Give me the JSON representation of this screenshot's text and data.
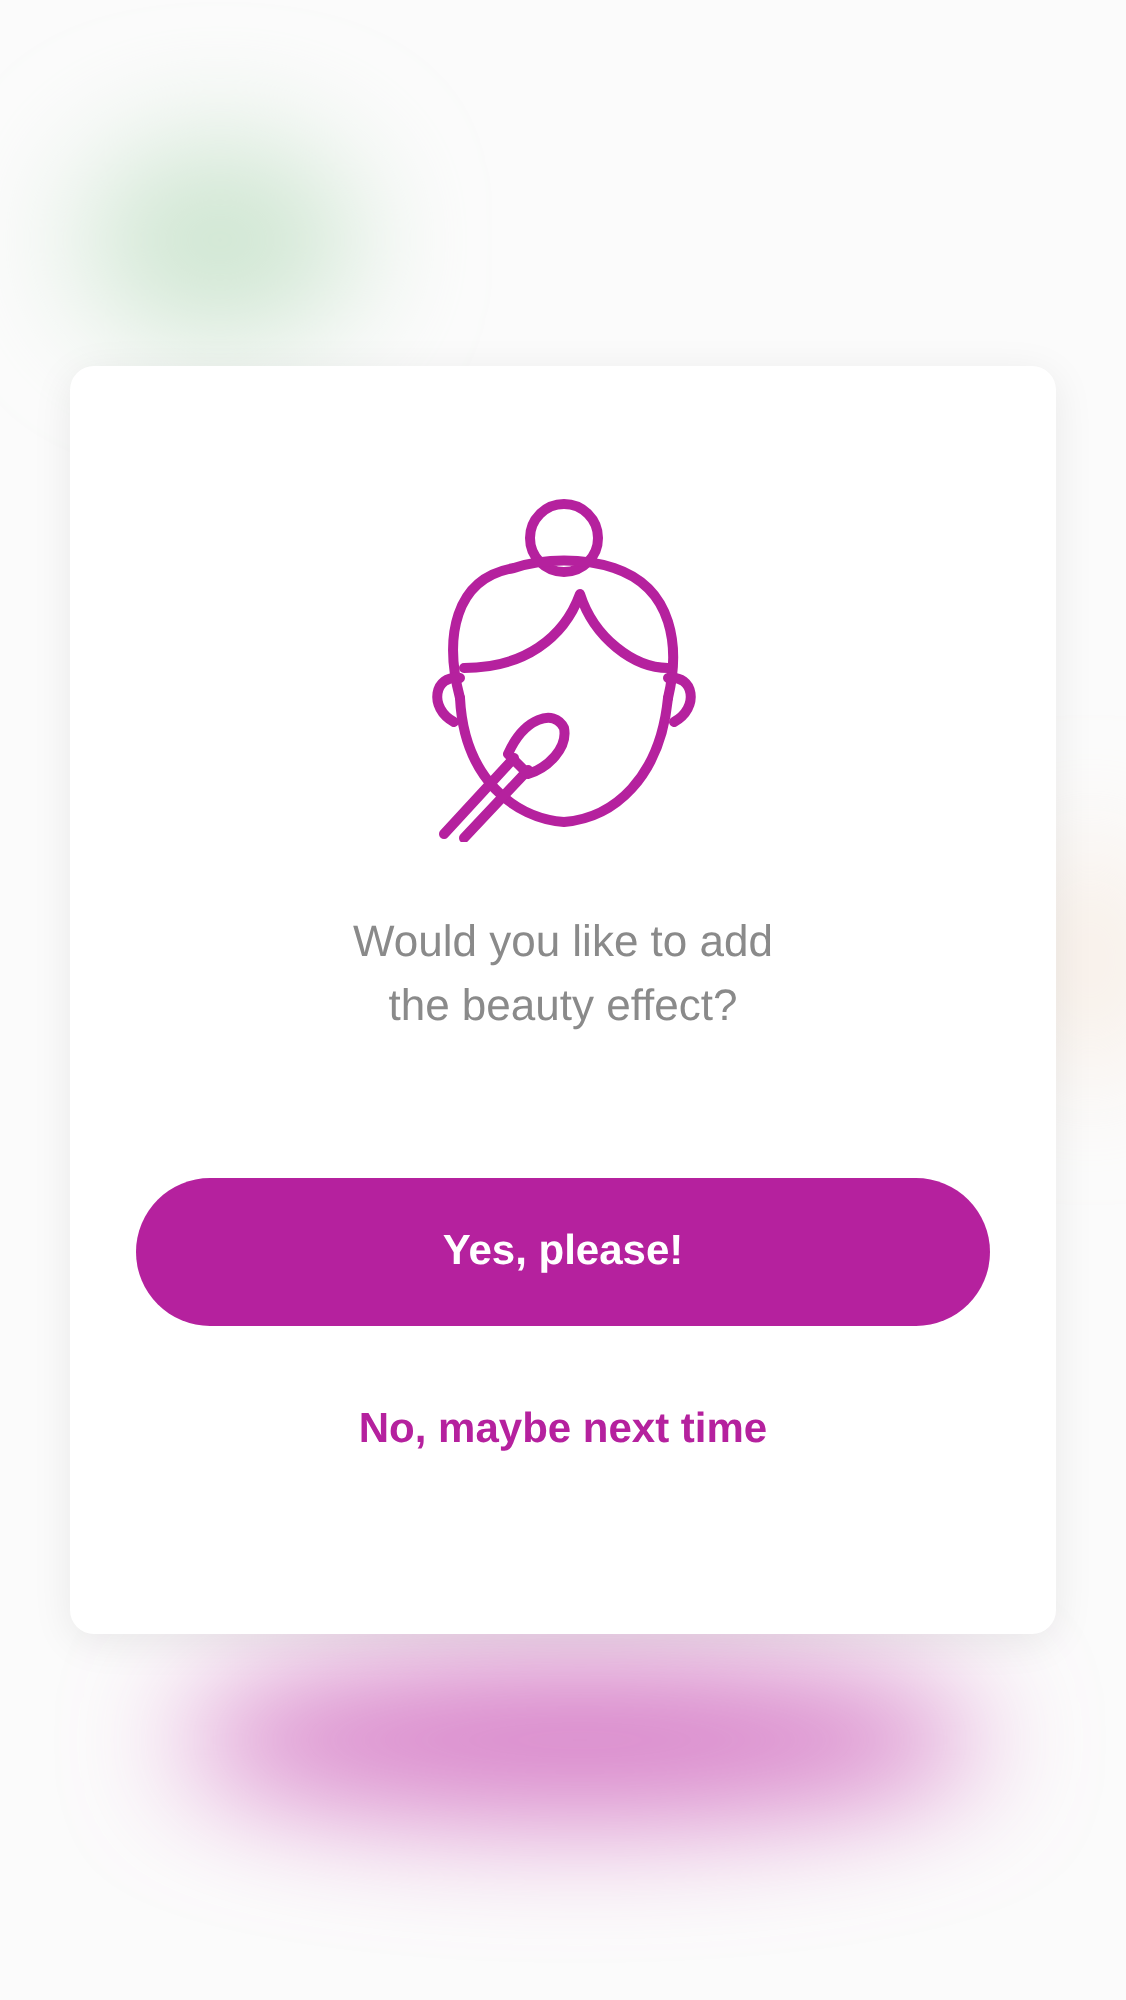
{
  "dialog": {
    "message": "Would you like to add the beauty effect?",
    "primary_button": "Yes, please!",
    "secondary_link": "No, maybe next time"
  }
}
